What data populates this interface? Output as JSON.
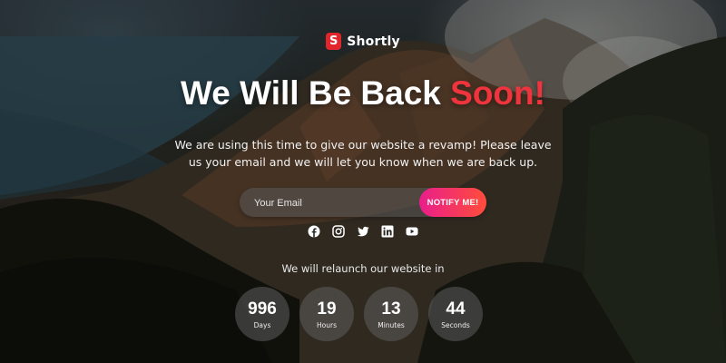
{
  "brand": {
    "name": "Shortly",
    "mark": "S",
    "color": "#e0262c"
  },
  "headline": {
    "main": "We Will Be Back",
    "accent": "Soon!",
    "accent_color": "#f0343d"
  },
  "description": "We are using this time to give our website a revamp! Please leave us your email and we will let you know when we are back up.",
  "signup": {
    "placeholder": "Your Email",
    "value": "",
    "button": "NOTIFY ME!"
  },
  "social": [
    {
      "name": "facebook",
      "icon": "facebook-icon"
    },
    {
      "name": "instagram",
      "icon": "instagram-icon"
    },
    {
      "name": "twitter",
      "icon": "twitter-icon"
    },
    {
      "name": "linkedin",
      "icon": "linkedin-icon"
    },
    {
      "name": "youtube",
      "icon": "youtube-icon"
    }
  ],
  "relaunch_text": "We will relaunch our website in",
  "countdown": [
    {
      "value": "996",
      "label": "Days"
    },
    {
      "value": "19",
      "label": "Hours"
    },
    {
      "value": "13",
      "label": "Minutes"
    },
    {
      "value": "44",
      "label": "Seconds"
    }
  ],
  "colors": {
    "button_start": "#e91e8c",
    "button_end": "#ff4d3a"
  }
}
